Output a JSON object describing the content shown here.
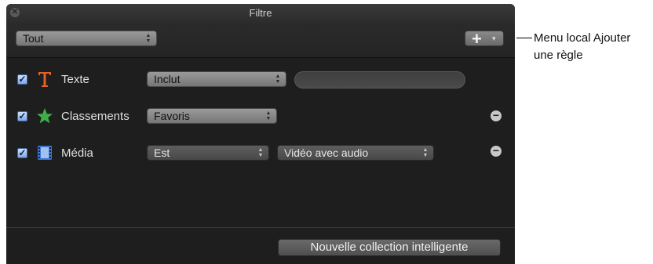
{
  "window": {
    "title": "Filtre"
  },
  "toolbar": {
    "scope_value": "Tout",
    "add_menu_glyph": "+",
    "add_menu_arrow": "▾"
  },
  "rules": [
    {
      "checked": true,
      "label": "Texte",
      "icon": "text-T-icon",
      "operator": "Inclut",
      "value_placeholder": ""
    },
    {
      "checked": true,
      "label": "Classements",
      "icon": "star-icon",
      "operator": "Favoris"
    },
    {
      "checked": true,
      "label": "Média",
      "icon": "film-icon",
      "operator": "Est",
      "value": "Vidéo avec audio"
    }
  ],
  "footer": {
    "new_collection_label": "Nouvelle collection intelligente"
  },
  "callout": {
    "text": "Menu local Ajouter une règle"
  },
  "colors": {
    "panel_bg": "#1e1e1e",
    "text_icon": "#e0612a",
    "star_icon": "#3fae4a",
    "film_icon": "#3f78d0",
    "checkbox": "#7ea6e6"
  }
}
